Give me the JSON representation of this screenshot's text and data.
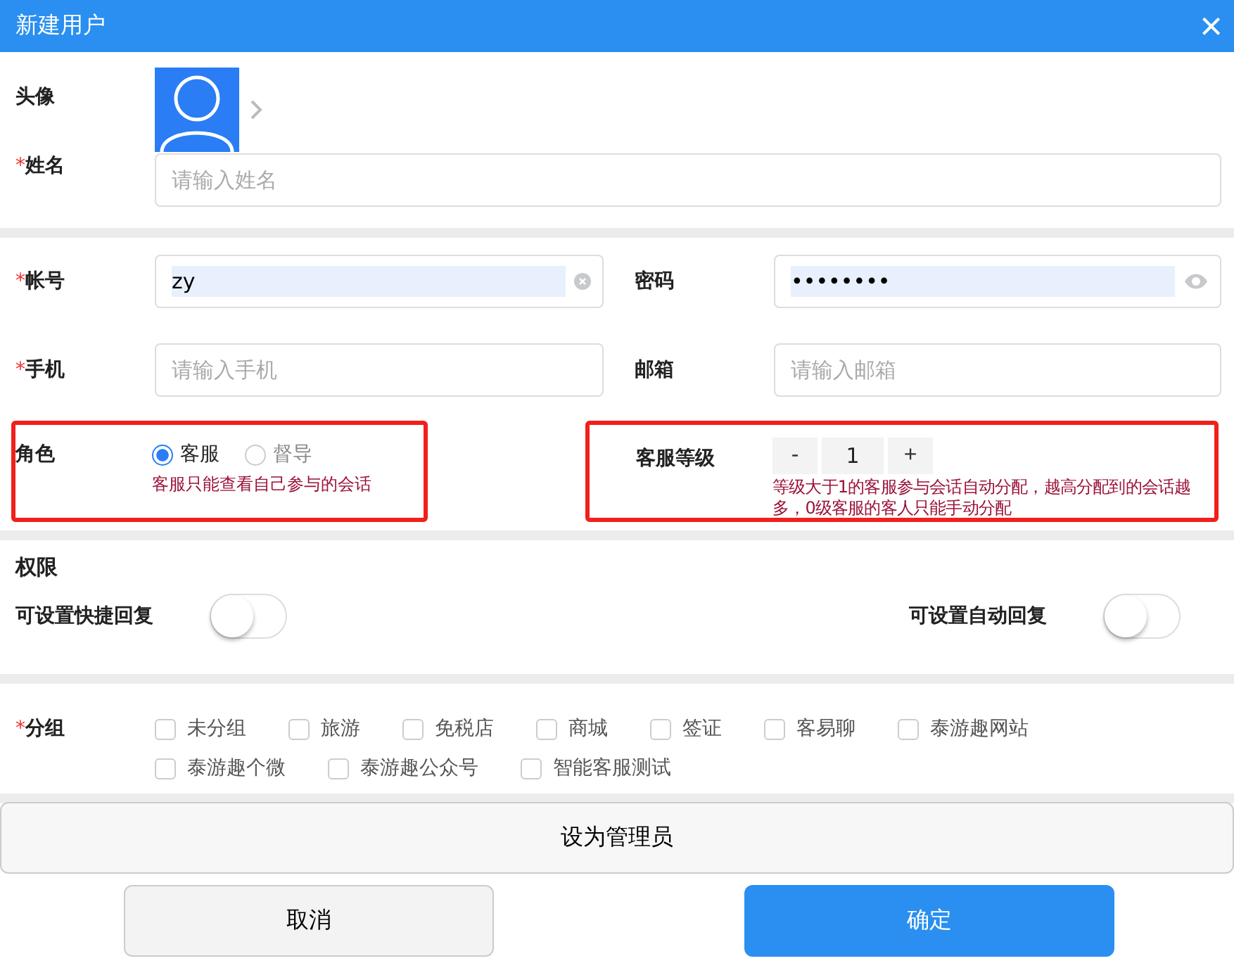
{
  "window": {
    "title": "新建用户",
    "close": "×"
  },
  "avatar": {
    "label": "头像"
  },
  "name": {
    "label": "姓名",
    "required_mark": "*",
    "placeholder": "请输入姓名"
  },
  "account": {
    "label": "帐号",
    "required_mark": "*",
    "value": "zy"
  },
  "password": {
    "label": "密码",
    "value": "••••••••"
  },
  "phone": {
    "label": "手机",
    "required_mark": "*",
    "placeholder": "请输入手机"
  },
  "email": {
    "label": "邮箱",
    "placeholder": "请输入邮箱"
  },
  "role": {
    "label": "角色",
    "options": [
      {
        "label": "客服",
        "selected": true
      },
      {
        "label": "督导",
        "selected": false
      }
    ],
    "hint": "客服只能查看自己参与的会话"
  },
  "level": {
    "label": "客服等级",
    "minus": "-",
    "value": "1",
    "plus": "+",
    "hint": "等级大于1的客服参与会话自动分配，越高分配到的会话越多，0级客服的客人只能手动分配"
  },
  "permissions": {
    "title": "权限",
    "items": [
      {
        "label": "可设置快捷回复",
        "on": false
      },
      {
        "label": "可设置自动回复",
        "on": false
      }
    ]
  },
  "groups": {
    "label": "分组",
    "required_mark": "*",
    "items": [
      {
        "label": "未分组",
        "checked": false
      },
      {
        "label": "旅游",
        "checked": false
      },
      {
        "label": "免税店",
        "checked": false
      },
      {
        "label": "商城",
        "checked": false
      },
      {
        "label": "签证",
        "checked": false
      },
      {
        "label": "客易聊",
        "checked": false
      },
      {
        "label": "泰游趣网站",
        "checked": false
      },
      {
        "label": "泰游趣个微",
        "checked": false
      },
      {
        "label": "泰游趣公众号",
        "checked": false
      },
      {
        "label": "智能客服测试",
        "checked": false
      }
    ]
  },
  "admin_button": "设为管理员",
  "buttons": [
    {
      "label": "取消",
      "kind": "secondary"
    },
    {
      "label": "确定",
      "kind": "primary"
    }
  ]
}
